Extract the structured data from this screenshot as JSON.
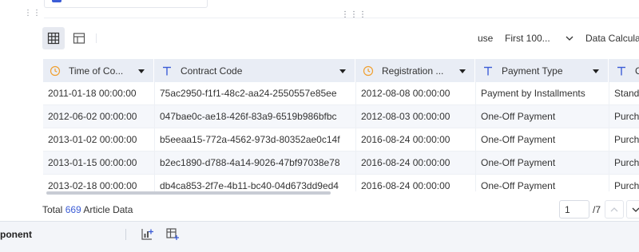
{
  "toolbar": {
    "use_label": "use",
    "use_select_value": "First 100...",
    "data_calc_label": "Data Calcula"
  },
  "columns": [
    {
      "label": "Time of Co...",
      "type_icon": "clock-icon"
    },
    {
      "label": "Contract Code",
      "type_icon": "text-type-icon"
    },
    {
      "label": "Registration ...",
      "type_icon": "clock-icon"
    },
    {
      "label": "Payment Type",
      "type_icon": "text-type-icon"
    },
    {
      "label": "C",
      "type_icon": "text-type-icon"
    }
  ],
  "rows": [
    {
      "time": "2011-01-18 00:00:00",
      "code": "75ac2950-f1f1-48c2-aa24-2550557e85ee",
      "reg": "2012-08-08 00:00:00",
      "pay": "Payment by Installments",
      "extra": "Standi"
    },
    {
      "time": "2012-06-02 00:00:00",
      "code": "047bae0c-ae18-426f-83a9-6519b986bfbc",
      "reg": "2012-08-03 00:00:00",
      "pay": "One-Off Payment",
      "extra": "Purcha"
    },
    {
      "time": "2013-01-02 00:00:00",
      "code": "b5eeaa15-772a-4562-973d-80352ae0c14f",
      "reg": "2016-08-24 00:00:00",
      "pay": "One-Off Payment",
      "extra": "Purcha"
    },
    {
      "time": "2013-01-15 00:00:00",
      "code": "b2ec1890-d788-4a14-9026-47bf97038e78",
      "reg": "2016-08-24 00:00:00",
      "pay": "One-Off Payment",
      "extra": "Purcha"
    },
    {
      "time": "2013-02-18 00:00:00",
      "code": "db4ca853-2f7e-4b11-bc40-04d673dd9ed4",
      "reg": "2016-08-24 00:00:00",
      "pay": "One-Off Payment",
      "extra": "Purcha"
    }
  ],
  "footer": {
    "total_prefix": "Total",
    "total_count": "669",
    "total_suffix": "Article Data",
    "page_current": "1",
    "page_total": "/7"
  },
  "bottom_bar": {
    "title": "ponent"
  },
  "colors": {
    "accent": "#3b5cd6",
    "header_bg": "#e9edf5",
    "clock_icon": "#f0a030",
    "text_icon": "#3b5cd6"
  }
}
